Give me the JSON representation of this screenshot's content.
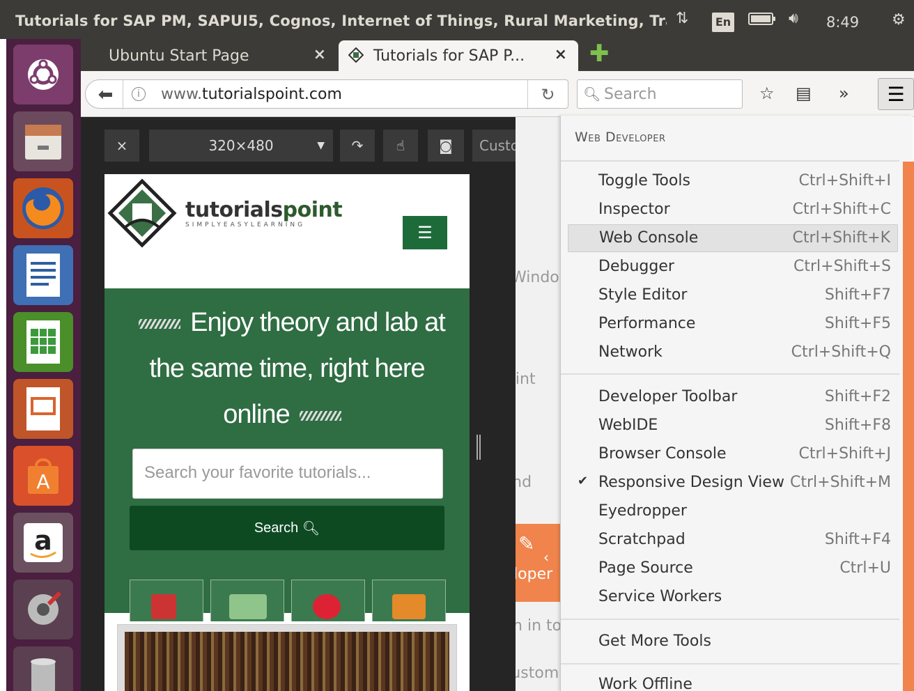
{
  "window_title": "Tutorials for SAP PM, SAPUI5, Cognos, Internet of Things, Rural Marketing, Tra",
  "top_panel": {
    "keyboard_layout": "En",
    "clock": "8:49"
  },
  "tabs": [
    {
      "label": "Ubuntu Start Page",
      "close": "×"
    },
    {
      "label": "Tutorials for SAP P...",
      "close": "×"
    }
  ],
  "nav": {
    "url_host": "www.",
    "url_domain": "tutorialspoint.com",
    "search_placeholder": "Search",
    "overflow": "»"
  },
  "responsive_toolbar": {
    "close": "×",
    "size": "320×480",
    "custom": "Custom"
  },
  "site": {
    "logo_word1": "tutorials",
    "logo_word2": "point",
    "tagline": "SIMPLYEASYLEARNING",
    "hero_line1": "Enjoy theory and lab at",
    "hero_line2": "the same time, right here",
    "hero_line3": "online",
    "search_placeholder": "Search your favorite tutorials...",
    "search_button": "Search"
  },
  "behind_menu_fragments": [
    "Window",
    "Print",
    "Find",
    "Developer",
    "Sign in to",
    "Customize"
  ],
  "web_developer_menu": {
    "title": "Web Developer",
    "group1": [
      {
        "label": "Toggle Tools",
        "shortcut": "Ctrl+Shift+I"
      },
      {
        "label": "Inspector",
        "shortcut": "Ctrl+Shift+C"
      },
      {
        "label": "Web Console",
        "shortcut": "Ctrl+Shift+K"
      },
      {
        "label": "Debugger",
        "shortcut": "Ctrl+Shift+S"
      },
      {
        "label": "Style Editor",
        "shortcut": "Shift+F7"
      },
      {
        "label": "Performance",
        "shortcut": "Shift+F5"
      },
      {
        "label": "Network",
        "shortcut": "Ctrl+Shift+Q"
      }
    ],
    "group2": [
      {
        "label": "Developer Toolbar",
        "shortcut": "Shift+F2"
      },
      {
        "label": "WebIDE",
        "shortcut": "Shift+F8"
      },
      {
        "label": "Browser Console",
        "shortcut": "Ctrl+Shift+J"
      },
      {
        "label": "Responsive Design View",
        "shortcut": "Ctrl+Shift+M",
        "checked": true
      },
      {
        "label": "Eyedropper",
        "shortcut": ""
      },
      {
        "label": "Scratchpad",
        "shortcut": "Shift+F4"
      },
      {
        "label": "Page Source",
        "shortcut": "Ctrl+U"
      },
      {
        "label": "Service Workers",
        "shortcut": ""
      }
    ],
    "group3": [
      {
        "label": "Get More Tools"
      }
    ],
    "group4": [
      {
        "label": "Work Offline"
      }
    ]
  },
  "colors": {
    "accent": "#f0844c",
    "site_green": "#2f6d43",
    "launcher": "#4a1f3f"
  }
}
